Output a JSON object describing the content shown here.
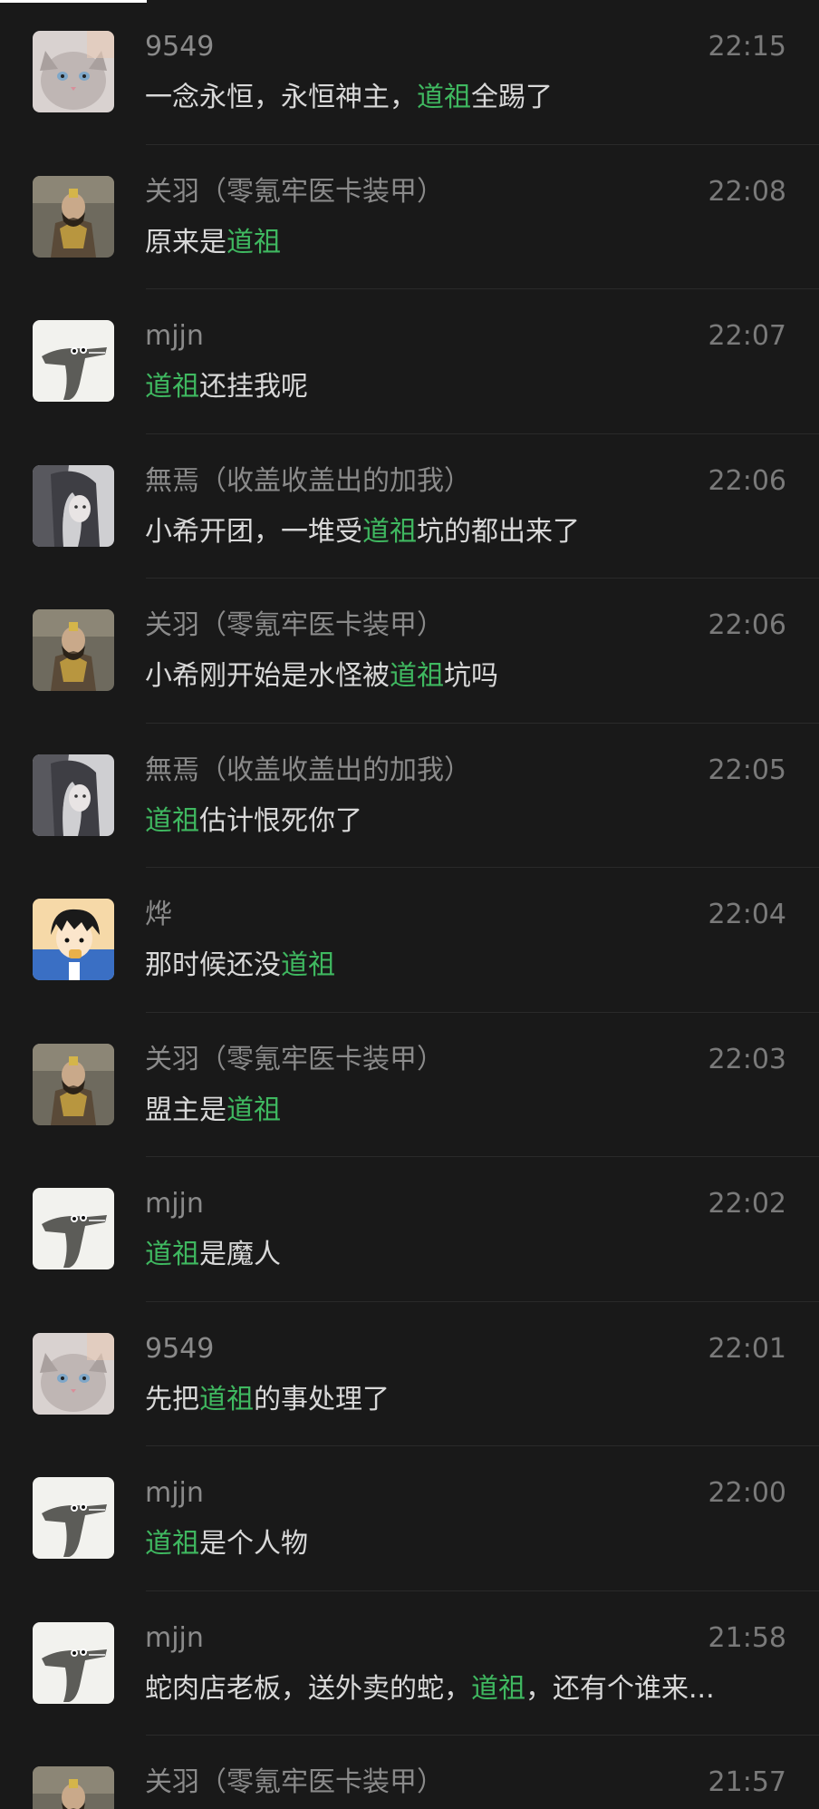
{
  "colors": {
    "background": "#191919",
    "sender_name": "#8a8a8a",
    "timestamp": "#7a7a7a",
    "message_text": "#d8d8d8",
    "highlight": "#3fb860"
  },
  "messages": [
    {
      "sender": "9549",
      "time": "22:15",
      "avatar": "cat-avatar",
      "parts": [
        "一念永恒，永恒神主，",
        "道祖",
        "全踢了"
      ]
    },
    {
      "sender": "关羽（零氪牢医卡装甲）",
      "time": "22:08",
      "avatar": "warrior-avatar",
      "parts": [
        "原来是",
        "道祖",
        ""
      ]
    },
    {
      "sender": "mjjn",
      "time": "22:07",
      "avatar": "crocodile-avatar",
      "parts": [
        "",
        "道祖",
        "还挂我呢"
      ]
    },
    {
      "sender": "無焉（收盖收盖出的加我）",
      "time": "22:06",
      "avatar": "girl-avatar",
      "parts": [
        "小希开团，一堆受",
        "道祖",
        "坑的都出来了"
      ]
    },
    {
      "sender": "关羽（零氪牢医卡装甲）",
      "time": "22:06",
      "avatar": "warrior-avatar",
      "parts": [
        "小希刚开始是水怪被",
        "道祖",
        "坑吗"
      ]
    },
    {
      "sender": "無焉（收盖收盖出的加我）",
      "time": "22:05",
      "avatar": "girl-avatar",
      "parts": [
        "",
        "道祖",
        "估计恨死你了"
      ]
    },
    {
      "sender": "烨",
      "time": "22:04",
      "avatar": "cartoon-boy-avatar",
      "parts": [
        "那时候还没",
        "道祖",
        ""
      ]
    },
    {
      "sender": "关羽（零氪牢医卡装甲）",
      "time": "22:03",
      "avatar": "warrior-avatar",
      "parts": [
        "盟主是",
        "道祖",
        ""
      ]
    },
    {
      "sender": "mjjn",
      "time": "22:02",
      "avatar": "crocodile-avatar",
      "parts": [
        "",
        "道祖",
        "是魔人"
      ]
    },
    {
      "sender": "9549",
      "time": "22:01",
      "avatar": "cat-avatar",
      "parts": [
        "先把",
        "道祖",
        "的事处理了"
      ]
    },
    {
      "sender": "mjjn",
      "time": "22:00",
      "avatar": "crocodile-avatar",
      "parts": [
        "",
        "道祖",
        "是个人物"
      ]
    },
    {
      "sender": "mjjn",
      "time": "21:58",
      "avatar": "crocodile-avatar",
      "parts": [
        "蛇肉店老板，送外卖的蛇，",
        "道祖",
        "，还有个谁来..."
      ]
    },
    {
      "sender": "关羽（零氪牢医卡装甲）",
      "time": "21:57",
      "avatar": "warrior-avatar",
      "parts": [
        "",
        "",
        ""
      ]
    }
  ]
}
